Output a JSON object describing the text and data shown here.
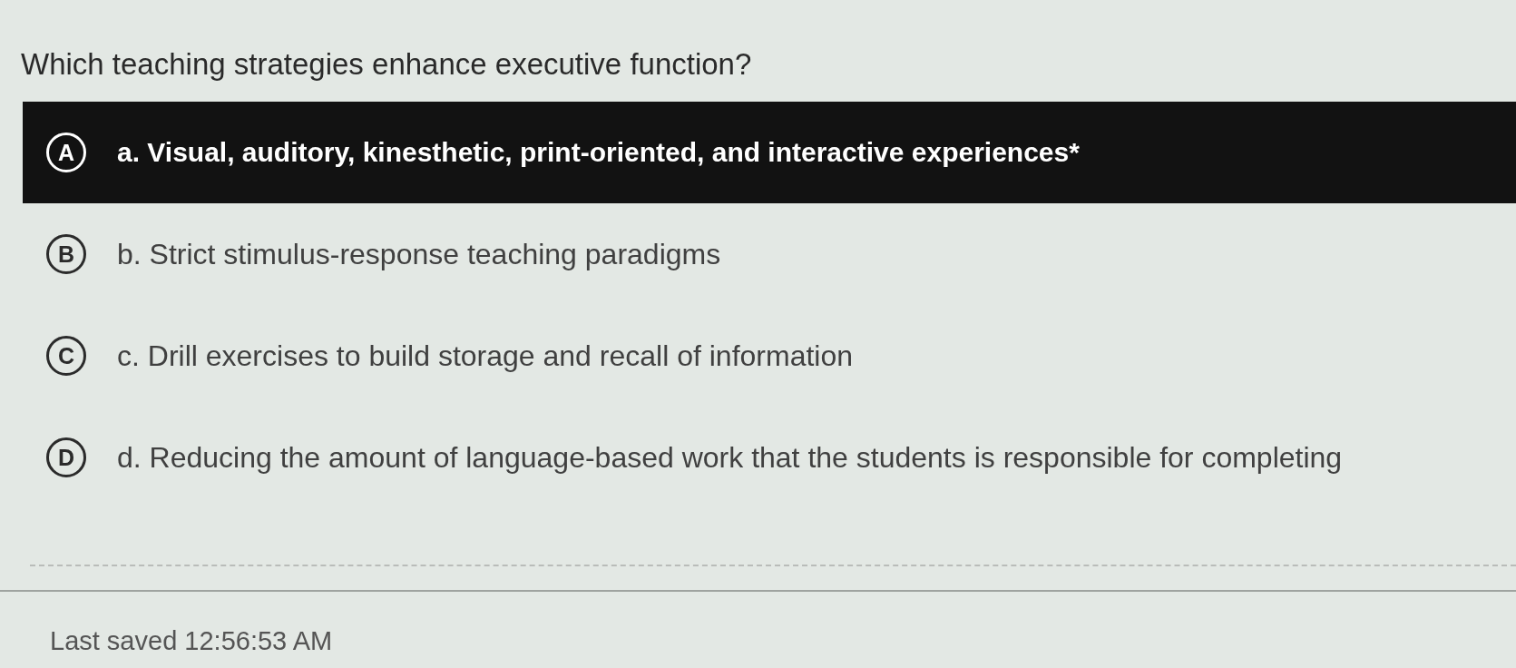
{
  "question": "Which teaching strategies enhance executive function?",
  "options": [
    {
      "letter": "A",
      "text": "a. Visual, auditory, kinesthetic, print-oriented, and interactive experiences*",
      "selected": true
    },
    {
      "letter": "B",
      "text": "b. Strict stimulus-response teaching paradigms",
      "selected": false
    },
    {
      "letter": "C",
      "text": "c. Drill exercises to build storage and recall of information",
      "selected": false
    },
    {
      "letter": "D",
      "text": "d. Reducing the amount of language-based work that the students is responsible for completing",
      "selected": false
    }
  ],
  "status": "Last saved 12:56:53 AM"
}
